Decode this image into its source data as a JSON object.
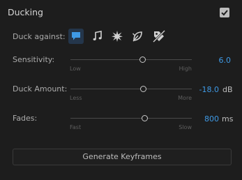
{
  "header": {
    "title": "Ducking",
    "enabled": true
  },
  "duck_against": {
    "label": "Duck against:",
    "options": [
      {
        "name": "dialogue",
        "icon": "speech-bubble-icon",
        "selected": true
      },
      {
        "name": "music",
        "icon": "music-note-icon",
        "selected": false
      },
      {
        "name": "sfx",
        "icon": "burst-icon",
        "selected": false
      },
      {
        "name": "ambience",
        "icon": "leaf-icon",
        "selected": false
      },
      {
        "name": "unassigned",
        "icon": "no-tag-icon",
        "selected": false
      }
    ]
  },
  "sensitivity": {
    "label": "Sensitivity:",
    "min_label": "Low",
    "max_label": "High",
    "value": "6.0",
    "unit": "",
    "level": 0.59
  },
  "duck_amount": {
    "label": "Duck Amount:",
    "min_label": "Less",
    "max_label": "More",
    "value": "-18.0",
    "unit": "dB",
    "level": 0.6
  },
  "fades": {
    "label": "Fades:",
    "min_label": "Fast",
    "max_label": "Slow",
    "value": "800",
    "unit": "ms",
    "level": 0.61
  },
  "generate_button": {
    "label": "Generate Keyframes"
  },
  "colors": {
    "accent": "#3f9ae6",
    "background": "#1d1d1d",
    "selected_icon_bg": "#24364b"
  }
}
